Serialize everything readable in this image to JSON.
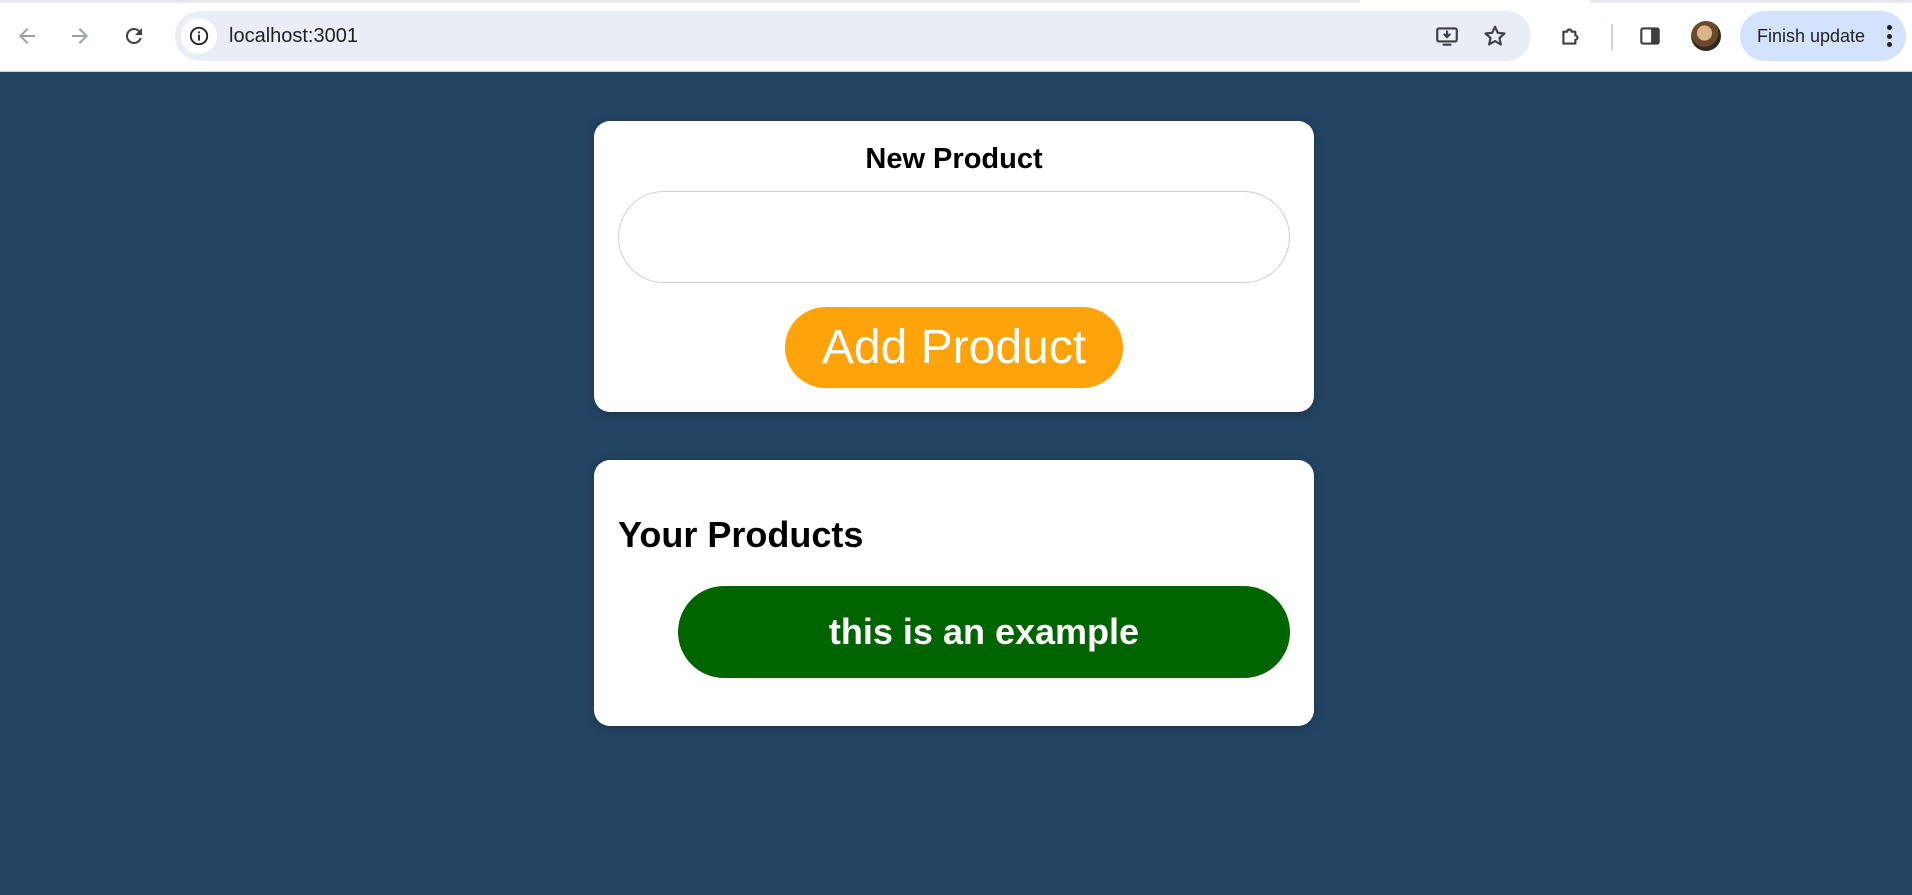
{
  "browser": {
    "url": "localhost:3001",
    "update_label": "Finish update",
    "icons": {
      "back": "arrow-left-icon",
      "forward": "arrow-right-icon",
      "reload": "reload-icon",
      "site_info": "info-icon",
      "install": "install-app-icon",
      "bookmark": "star-icon",
      "extensions": "puzzle-icon",
      "side_panel": "side-panel-icon",
      "profile": "avatar",
      "menu": "kebab-menu-icon"
    }
  },
  "colors": {
    "page_background": "#244463",
    "add_button": "#ffa30a",
    "product_item": "#006400"
  },
  "new_product": {
    "title": "New Product",
    "input_value": "",
    "input_placeholder": "",
    "add_button_label": "Add Product"
  },
  "products": {
    "title": "Your Products",
    "items": [
      {
        "label": "this is an example"
      }
    ]
  }
}
